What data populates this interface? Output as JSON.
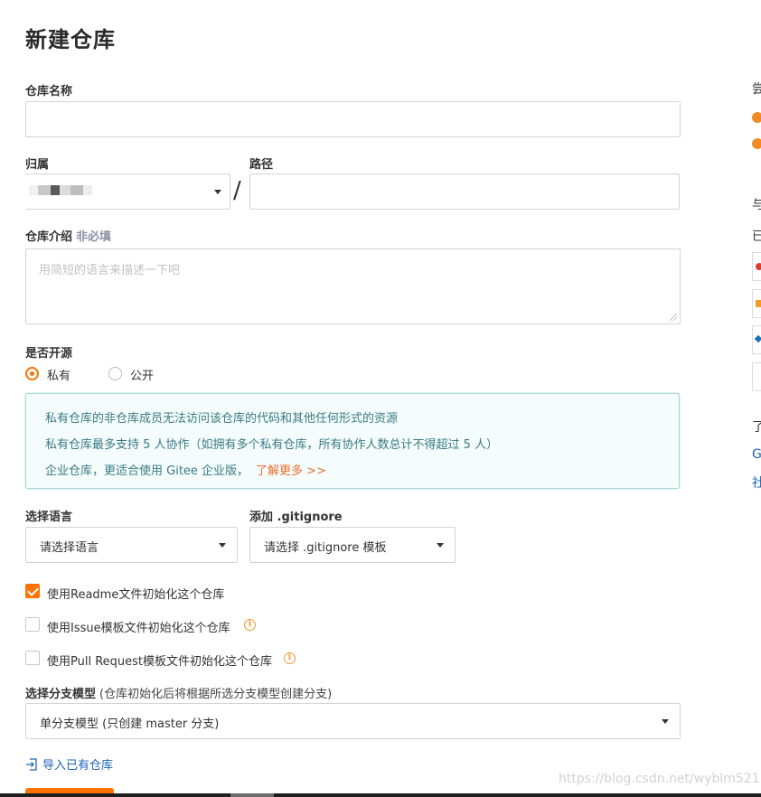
{
  "page": {
    "title": "新建仓库"
  },
  "repo_name": {
    "label": "仓库名称",
    "value": ""
  },
  "owner": {
    "label": "归属",
    "value": ""
  },
  "path": {
    "label": "路径",
    "separator": "/",
    "value": ""
  },
  "description": {
    "label": "仓库介绍",
    "optional_tag": "非必填",
    "placeholder": "用简短的语言来描述一下吧"
  },
  "visibility": {
    "label": "是否开源",
    "options": [
      {
        "label": "私有",
        "checked": true
      },
      {
        "label": "公开",
        "checked": false
      }
    ]
  },
  "notice": {
    "lines": [
      "私有仓库的非仓库成员无法访问该仓库的代码和其他任何形式的资源",
      "私有仓库最多支持 5 人协作（如拥有多个私有仓库，所有协作人数总计不得超过 5 人）",
      "企业仓库，更适合使用 Gitee 企业版，"
    ],
    "link": "了解更多 >>"
  },
  "language": {
    "label": "选择语言",
    "value": "请选择语言"
  },
  "gitignore": {
    "label": "添加 .gitignore",
    "value": "请选择 .gitignore 模板"
  },
  "init_options": [
    {
      "label": "使用Readme文件初始化这个仓库",
      "checked": true,
      "info": false
    },
    {
      "label": "使用Issue模板文件初始化这个仓库",
      "checked": false,
      "info": true
    },
    {
      "label": "使用Pull Request模板文件初始化这个仓库",
      "checked": false,
      "info": true
    }
  ],
  "branch_model": {
    "label": "选择分支模型",
    "hint": "(仓库初始化后将根据所选分支模型创建分支)",
    "value": "单分支模型 (只创建 master 分支)"
  },
  "import": {
    "label": "导入已有仓库"
  },
  "watermark": "https://blog.csdn.net/wyblm521",
  "sidebar": {
    "texts": [
      "尝",
      "与",
      "已",
      "了",
      "G",
      "社"
    ]
  },
  "colors": {
    "accent": "#fe7300",
    "notice_bg": "#f4fcfc",
    "notice_text": "#3a7b83",
    "link": "#f06d2f"
  },
  "icons": {
    "dropdown": "caret-down-icon",
    "info": "info-circle-icon",
    "import": "import-icon"
  }
}
